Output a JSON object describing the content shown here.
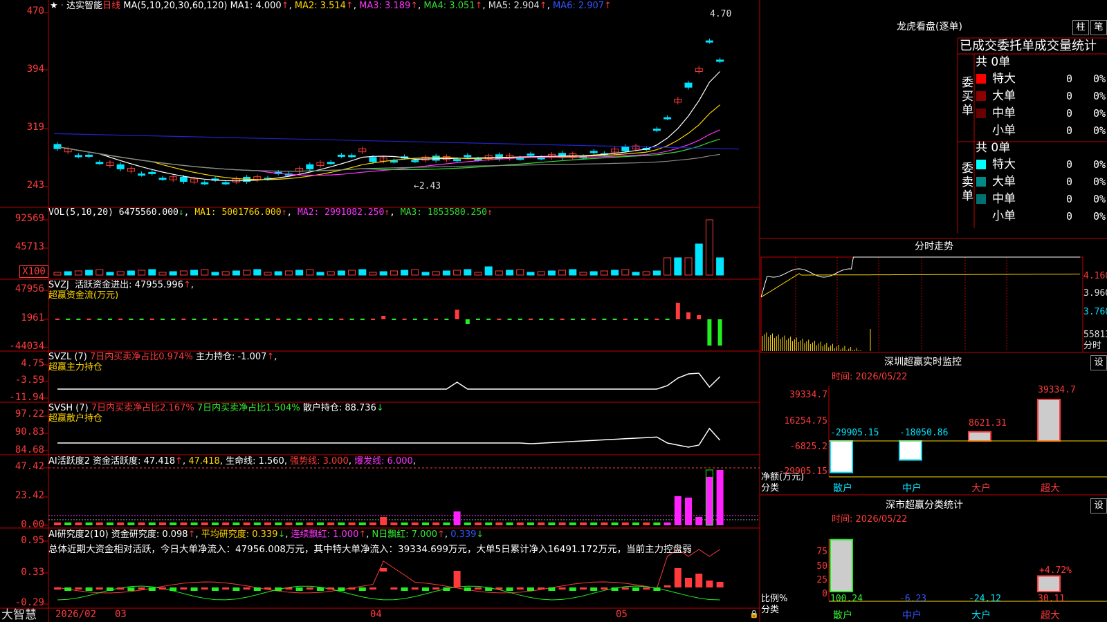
{
  "colors": {
    "up": "#ff3b3b",
    "down": "#00e5ff",
    "ma1": "#ffffff",
    "ma2": "#ffd700",
    "ma3": "#ff33ff",
    "ma4": "#33dd33",
    "ma5": "#888888",
    "ma6": "#2222cc",
    "grid": "#c00000",
    "axis": "#ff3b3b",
    "green": "#22ee22",
    "mag": "#ff22ff"
  },
  "kline": {
    "stock_name": "达实智能",
    "period": "日线",
    "ma_label": "MA(5,10,20,30,60,120)",
    "ma1": "MA1: 4.000",
    "ma2": "MA2: 3.514",
    "ma3": "MA3: 3.189",
    "ma4": "MA4: 3.051",
    "ma5": "MA5: 2.904",
    "ma6": "MA6: 2.907",
    "high_label": "4.70",
    "low_label": "2.43",
    "ticks": [
      "470",
      "394",
      "319",
      "243"
    ]
  },
  "volume": {
    "title": "VOL(5,10,20)",
    "vol": "6475560.000",
    "ma1": "MA1: 5001766.000",
    "ma2": "MA2: 2991082.250",
    "ma3": "MA3: 1853580.250",
    "ticks": [
      "92569",
      "45713"
    ],
    "unit": "X100"
  },
  "svzj": {
    "title": "SVZJ",
    "label": "活跃资金进出: 47955.996",
    "subtitle": "超赢资金流(万元)",
    "ticks": [
      "47956",
      "1961",
      "-44034"
    ]
  },
  "svzl": {
    "title": "SVZL (7)",
    "label1": "7日内买卖净占比0.974%",
    "label2": "主力持仓: -1.007",
    "subtitle": "超赢主力持仓",
    "ticks": [
      "4.75",
      "-3.59",
      "-11.94"
    ]
  },
  "svsh": {
    "title": "SVSH (7)",
    "label1": "7日内买卖净占比2.167%",
    "label2": "7日内买卖净占比1.504%",
    "label3": "散户持仓: 88.736",
    "subtitle": "超赢散户持仓",
    "ticks": [
      "97.22",
      "90.83",
      "84.68"
    ]
  },
  "ai_active": {
    "title": "AI活跃度2",
    "label1": "资金活跃度: 47.418",
    "label2": "47.418",
    "label3": "生命线: 1.560",
    "label4": "强势线: 3.000",
    "label5": "爆发线: 6.000",
    "ticks": [
      "47.42",
      "23.42",
      "0.00"
    ]
  },
  "ai_research": {
    "title": "AI研究度2(10)",
    "label1": "资金研究度: 0.098",
    "label2": "平均研究度: 0.339",
    "label3": "连续飘红: 1.000",
    "label4": "N日飘红: 7.000",
    "label5": "0.339",
    "summary": "总体近期大资金相对活跃，今日大单净流入：47956.008万元，其中特大单净流入：39334.699万元，大单5日累计净入16491.172万元，当前主力控盘弱",
    "ticks": [
      "0.95",
      "0.33",
      "-0.29"
    ]
  },
  "bottom": {
    "brand": "大智慧",
    "dates": [
      "2026/02",
      "03",
      "04",
      "05"
    ]
  },
  "right": {
    "longhu_title": "龙虎看盘(逐单)",
    "btn_zhu": "柱",
    "btn_bi": "笔",
    "stats_title": "已成交委托单成交量统计",
    "buy": {
      "side": "委买单",
      "total": "共 0单",
      "rows": [
        {
          "name": "特大",
          "v": "0",
          "p": "0%",
          "color": "#ff0000"
        },
        {
          "name": "大单",
          "v": "0",
          "p": "0%",
          "color": "#8b0000"
        },
        {
          "name": "中单",
          "v": "0",
          "p": "0%",
          "color": "#6b0000"
        },
        {
          "name": "小单",
          "v": "0",
          "p": "0%",
          "color": ""
        }
      ]
    },
    "sell": {
      "side": "委卖单",
      "total": "共 0单",
      "rows": [
        {
          "name": "特大",
          "v": "0",
          "p": "0%",
          "color": "#00ffff"
        },
        {
          "name": "大单",
          "v": "0",
          "p": "0%",
          "color": "#008b8b"
        },
        {
          "name": "中单",
          "v": "0",
          "p": "0%",
          "color": "#007070"
        },
        {
          "name": "小单",
          "v": "0",
          "p": "0%",
          "color": ""
        }
      ]
    },
    "intraday_title": "分时走势",
    "intraday_ticks": [
      "4.160",
      "3.960",
      "3.760"
    ],
    "intraday_vol": "55813",
    "intraday_unit": "分时",
    "sz_title": "深圳超赢实时监控",
    "sz_btn": "设",
    "sz_time": "时间: 2026/05/22",
    "sz_ticks": [
      "39334.7",
      "16254.75",
      "-6825.2",
      "-29905.15"
    ],
    "sz_bars": [
      {
        "cat": "散户",
        "v": -29905.15,
        "label": "-29905.15"
      },
      {
        "cat": "中户",
        "v": -18050.86,
        "label": "-18050.86"
      },
      {
        "cat": "大户",
        "v": 8621.31,
        "label": "8621.31"
      },
      {
        "cat": "超大",
        "v": 39334.7,
        "label": "39334.7"
      }
    ],
    "sz_ylabel1": "净额(万元)",
    "sz_ylabel2": "分类",
    "cls_title": "深市超赢分类统计",
    "cls_btn": "设",
    "cls_time": "时间: 2026/05/22",
    "cls_ticks": [
      "75",
      "50",
      "25",
      "0"
    ],
    "cls_bars": [
      {
        "cat": "散户",
        "v": 100.24,
        "label": "100.24"
      },
      {
        "cat": "中户",
        "v": -6.23,
        "label": "-6.23"
      },
      {
        "cat": "大户",
        "v": -24.12,
        "label": "-24.12"
      },
      {
        "cat": "超大",
        "v": 30.11,
        "label": "30.11"
      }
    ],
    "cls_pct": "+4.72%",
    "cls_ylabel1": "比例%",
    "cls_ylabel2": "分类"
  }
}
